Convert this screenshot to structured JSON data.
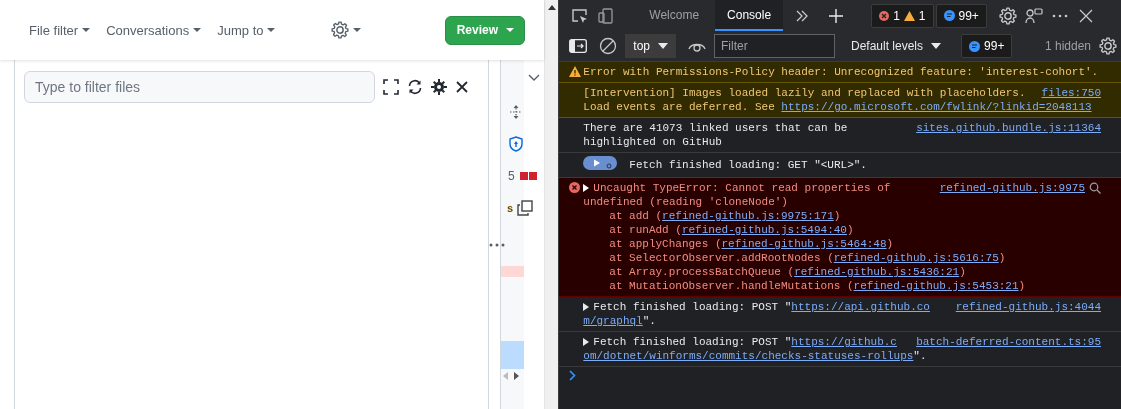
{
  "review_toolbar": {
    "menus": [
      {
        "label": "File filter"
      },
      {
        "label": "Conversations"
      },
      {
        "label": "Jump to"
      }
    ],
    "review_button": "Review"
  },
  "file_tree": {
    "filter": {
      "placeholder": "Type to filter files"
    }
  },
  "minimap": {
    "count": "5",
    "file_letter": "s"
  },
  "devtools": {
    "tabs": [
      {
        "label": "Welcome",
        "selected": false
      },
      {
        "label": "Console",
        "selected": true
      }
    ],
    "issue_counts": {
      "errors": "1",
      "warnings": "1",
      "messages": "99+"
    },
    "console_toolbar": {
      "context": "top",
      "filter": {
        "placeholder": "Filter"
      },
      "levels": "Default levels",
      "messages": "99+",
      "hidden": "1 hidden"
    },
    "messages": [
      {
        "kind": "warning",
        "icon": true,
        "expandable": false,
        "lines": [
          [
            {
              "text": "Error with Permissions-Policy header: Unrecognized feature: 'interest-cohort'."
            }
          ]
        ]
      },
      {
        "kind": "warning",
        "icon": false,
        "expandable": false,
        "source": "files:750",
        "lines": [
          [
            {
              "text": "[Intervention] Images loaded lazily and replaced with placeholders."
            }
          ],
          [
            {
              "text": "Load events are deferred. See "
            },
            {
              "link": "https://go.microsoft.com/fwlink/?linkid=2048113"
            }
          ]
        ]
      },
      {
        "kind": "info",
        "icon": false,
        "expandable": false,
        "source": "sites.github.bundle.js:11364",
        "lines": [
          [
            {
              "text": "There are 41073 linked users that can be"
            }
          ],
          [
            {
              "text": "highlighted on GitHub"
            }
          ]
        ]
      },
      {
        "kind": "info",
        "icon": false,
        "expandable": false,
        "badge": true,
        "lines": [
          [
            {
              "text": "Fetch finished loading: GET \"<URL>\"."
            }
          ]
        ]
      },
      {
        "kind": "error",
        "icon": true,
        "expandable": true,
        "source": "refined-github.js:9975",
        "lines": [
          [
            {
              "text": "Uncaught TypeError: Cannot read properties of"
            }
          ],
          [
            {
              "text": "undefined (reading 'cloneNode')"
            }
          ]
        ],
        "stack": [
          {
            "prefix": "at add (",
            "link": "refined-github.js:9975:171",
            "suffix": ")"
          },
          {
            "prefix": "at runAdd (",
            "link": "refined-github.js:5494:40",
            "suffix": ")"
          },
          {
            "prefix": "at applyChanges (",
            "link": "refined-github.js:5464:48",
            "suffix": ")"
          },
          {
            "prefix": "at SelectorObserver.addRootNodes (",
            "link": "refined-github.js:5616:75",
            "suffix": ")"
          },
          {
            "prefix": "at Array.processBatchQueue (",
            "link": "refined-github.js:5436:21",
            "suffix": ")"
          },
          {
            "prefix": "at MutationObserver.handleMutations (",
            "link": "refined-github.js:5453:21",
            "suffix": ")"
          }
        ]
      },
      {
        "kind": "info",
        "icon": false,
        "expandable": true,
        "source": "refined-github.js:4044",
        "lines": [
          [
            {
              "text": "Fetch finished loading: POST \""
            },
            {
              "link": "https://api.github.co"
            }
          ],
          [
            {
              "link": "m/graphql"
            },
            {
              "text": "\"."
            }
          ]
        ]
      },
      {
        "kind": "info",
        "icon": false,
        "expandable": true,
        "source": "batch-deferred-content.ts:95",
        "lines": [
          [
            {
              "text": "Fetch finished loading: POST \""
            },
            {
              "link": "https://github.c"
            }
          ],
          [
            {
              "link": "om/dotnet/winforms/commits/checks-statuses-rollups"
            },
            {
              "text": "\"."
            }
          ]
        ]
      }
    ]
  }
}
